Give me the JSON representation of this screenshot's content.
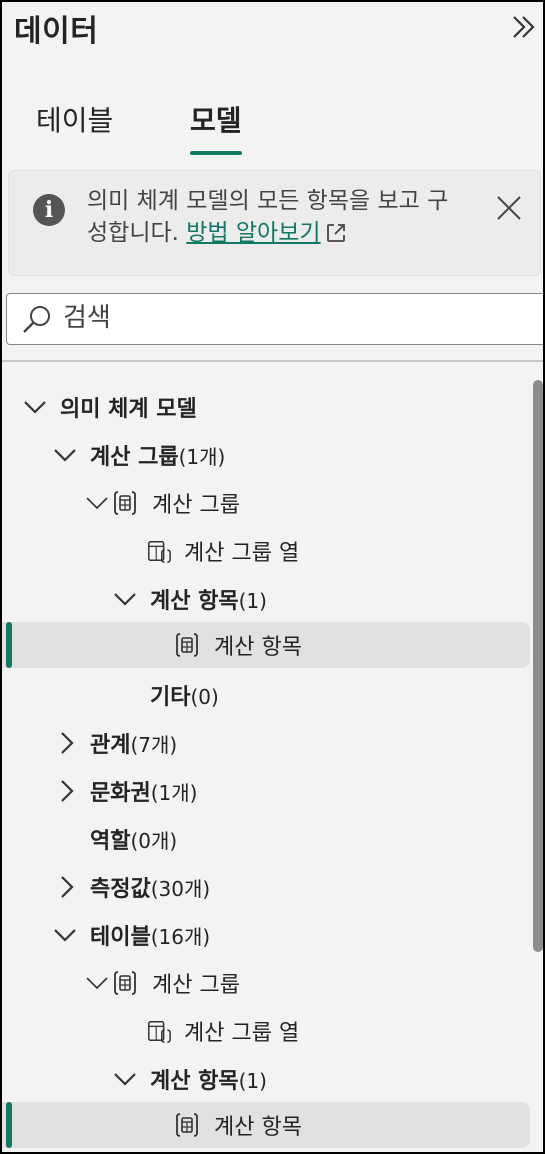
{
  "pane": {
    "title": "데이터"
  },
  "tabs": [
    {
      "label": "테이블",
      "active": false
    },
    {
      "label": "모델",
      "active": true
    }
  ],
  "info": {
    "text": "의미 체계 모델의 모든 항목을 보고 구성합니다.",
    "link": "방법 알아보기"
  },
  "search": {
    "placeholder": "검색"
  },
  "colors": {
    "accent": "#117865",
    "text": "#242424",
    "panel": "#f3f3f3"
  },
  "tree": {
    "root": "의미 체계 모델",
    "calc_groups": {
      "name": "계산 그룹",
      "count": "(1개)"
    },
    "calc_group_table_1": "계산 그룹",
    "calc_group_col_1": "계산 그룹 열",
    "calc_items_1": {
      "name": "계산 항목",
      "count": "(1)"
    },
    "calc_item_1": "계산 항목",
    "others": {
      "name": "기타",
      "count": "(0)"
    },
    "relations": {
      "name": "관계",
      "count": "(7개)"
    },
    "cultures": {
      "name": "문화권",
      "count": "(1개)"
    },
    "roles": {
      "name": "역할",
      "count": "(0개)"
    },
    "measures": {
      "name": "측정값",
      "count": "(30개)"
    },
    "tables": {
      "name": "테이블",
      "count": "(16개)"
    },
    "calc_group_table_2": "계산 그룹",
    "calc_group_col_2": "계산 그룹 열",
    "calc_items_2": {
      "name": "계산 항목",
      "count": "(1)"
    },
    "calc_item_2": "계산 항목"
  }
}
